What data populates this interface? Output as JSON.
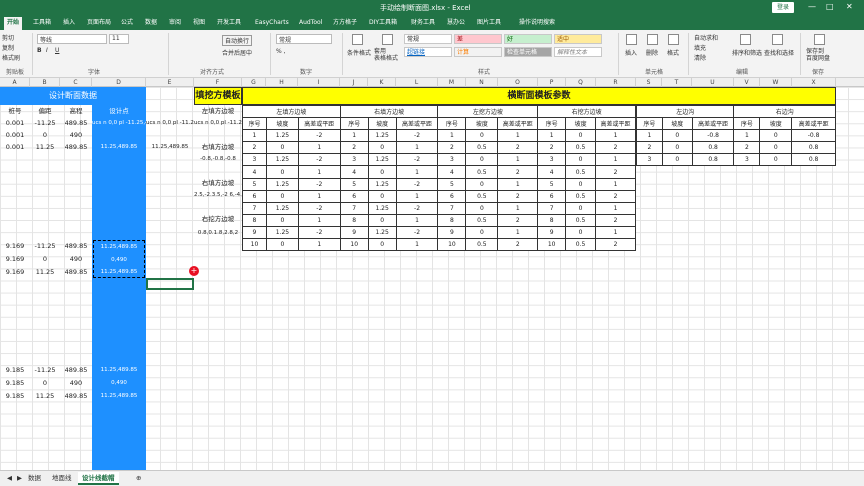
{
  "title": "手动绘制断面图.xlsx - Excel",
  "login_label": "登录",
  "tabs": [
    "开始",
    "工具箱",
    "插入",
    "页面布局",
    "公式",
    "数据",
    "审阅",
    "视图",
    "开发工具",
    "EasyCharts",
    "AudTool",
    "方方格子",
    "DIY工具箱",
    "财务工具",
    "慧办公",
    "图片工具",
    "操作说明搜索"
  ],
  "ribbon": {
    "paste": "粘贴",
    "cut": "剪切",
    "copy": "复制",
    "format_painter": "格式刷",
    "font_name": "等线",
    "font_size": "11",
    "wrap": "自动换行",
    "merge": "合并后居中",
    "num_format": "常规",
    "cond_format": "条件格式",
    "table_format": "套用\n表格格式",
    "styles": [
      "常规",
      "差",
      "好",
      "适中",
      "超链接",
      "计算",
      "检查单元格",
      "解释性文本"
    ],
    "insert": "插入",
    "delete": "删除",
    "format": "格式",
    "autosum": "自动求和",
    "fill": "填充",
    "clear": "清除",
    "sort": "排序和筛选",
    "find": "查找和选择",
    "save_cloud": "保存到\n百度网盘",
    "groups": [
      "剪贴板",
      "字体",
      "对齐方式",
      "数字",
      "样式",
      "单元格",
      "编辑",
      "保存"
    ]
  },
  "columns": [
    "A",
    "B",
    "C",
    "D",
    "E",
    "F",
    "G",
    "H",
    "I",
    "J",
    "K",
    "L",
    "M",
    "N",
    "O",
    "P",
    "Q",
    "R",
    "S",
    "T",
    "U",
    "V",
    "W",
    "X"
  ],
  "left": {
    "header": "设计断面数据",
    "col_labels": [
      "桩号",
      "偏距",
      "高程",
      "设计点"
    ],
    "block1": [
      [
        "0.001",
        "-11.25",
        "489.85"
      ],
      [
        "0.001",
        "0",
        "490"
      ],
      [
        "0.001",
        "11.25",
        "489.85"
      ]
    ],
    "block2": [
      [
        "9.169",
        "-11.25",
        "489.85"
      ],
      [
        "9.169",
        "0",
        "490"
      ],
      [
        "9.169",
        "11.25",
        "489.85"
      ]
    ],
    "block3": [
      [
        "9.185",
        "-11.25",
        "489.85"
      ],
      [
        "9.185",
        "0",
        "490"
      ],
      [
        "9.185",
        "11.25",
        "489.85"
      ]
    ],
    "d_text1": "ucs n 0,0 pl -11.25,489.85",
    "d_text2": "11.25,489.85",
    "d_val1": "0,490",
    "e_text1": "ucs n 0,0 pl -11.25,489.85",
    "e_text2": "11.25,489.85"
  },
  "fill_template": {
    "header": "填挖方模板",
    "items": [
      "左填方边坡",
      "右填方边坡",
      "右填方边坡",
      "右挖方边坡"
    ],
    "values": [
      "ucs n 0,0 pl -11.25,489.85",
      "-0.8,-0.8,-0.8",
      "2.5,-2.3.5,-2 6,-4.7,-4.9.5",
      "0.8,0.1.8,2.8,2"
    ]
  },
  "cross_section": {
    "title": "横断面模板参数",
    "groups": [
      "左填方边坡",
      "右填方边坡",
      "左挖方边坡",
      "右挖方边坡",
      "左边沟",
      "右边沟"
    ],
    "sub": [
      "序号",
      "坡度",
      "高差或平距"
    ],
    "left_fill": [
      [
        "1",
        "1.25",
        "-2"
      ],
      [
        "2",
        "0",
        "1"
      ],
      [
        "3",
        "1.25",
        "-2"
      ],
      [
        "4",
        "0",
        "1"
      ],
      [
        "5",
        "1.25",
        "-2"
      ],
      [
        "6",
        "0",
        "1"
      ],
      [
        "7",
        "1.25",
        "-2"
      ],
      [
        "8",
        "0",
        "1"
      ],
      [
        "9",
        "1.25",
        "-2"
      ],
      [
        "10",
        "0",
        "1"
      ]
    ],
    "right_fill": [
      [
        "1",
        "1.25",
        "-2"
      ],
      [
        "2",
        "0",
        "1"
      ],
      [
        "3",
        "1.25",
        "-2"
      ],
      [
        "4",
        "0",
        "1"
      ],
      [
        "5",
        "1.25",
        "-2"
      ],
      [
        "6",
        "0",
        "1"
      ],
      [
        "7",
        "1.25",
        "-2"
      ],
      [
        "8",
        "0",
        "1"
      ],
      [
        "9",
        "1.25",
        "-2"
      ],
      [
        "10",
        "0",
        "1"
      ]
    ],
    "left_cut": [
      [
        "1",
        "0",
        "1"
      ],
      [
        "2",
        "0.5",
        "2"
      ],
      [
        "3",
        "0",
        "1"
      ],
      [
        "4",
        "0.5",
        "2"
      ],
      [
        "5",
        "0",
        "1"
      ],
      [
        "6",
        "0.5",
        "2"
      ],
      [
        "7",
        "0",
        "1"
      ],
      [
        "8",
        "0.5",
        "2"
      ],
      [
        "9",
        "0",
        "1"
      ],
      [
        "10",
        "0.5",
        "2"
      ]
    ],
    "right_cut": [
      [
        "1",
        "0",
        "1"
      ],
      [
        "2",
        "0.5",
        "2"
      ],
      [
        "3",
        "0",
        "1"
      ],
      [
        "4",
        "0.5",
        "2"
      ],
      [
        "5",
        "0",
        "1"
      ],
      [
        "6",
        "0.5",
        "2"
      ],
      [
        "7",
        "0",
        "1"
      ],
      [
        "8",
        "0.5",
        "2"
      ],
      [
        "9",
        "0",
        "1"
      ],
      [
        "10",
        "0.5",
        "2"
      ]
    ],
    "left_ditch": [
      [
        "1",
        "0",
        "-0.8"
      ],
      [
        "2",
        "0",
        "0.8"
      ],
      [
        "3",
        "0",
        "0.8"
      ]
    ],
    "right_ditch": [
      [
        "1",
        "0",
        "-0.8"
      ],
      [
        "2",
        "0",
        "0.8"
      ],
      [
        "3",
        "0",
        "0.8"
      ]
    ]
  },
  "sheets": [
    "数据",
    "地面线",
    "设计线截帽"
  ],
  "active_sheet": 2,
  "colors": {
    "accent": "#217346",
    "blue": "#1e90ff",
    "yellow": "#ffff00"
  }
}
